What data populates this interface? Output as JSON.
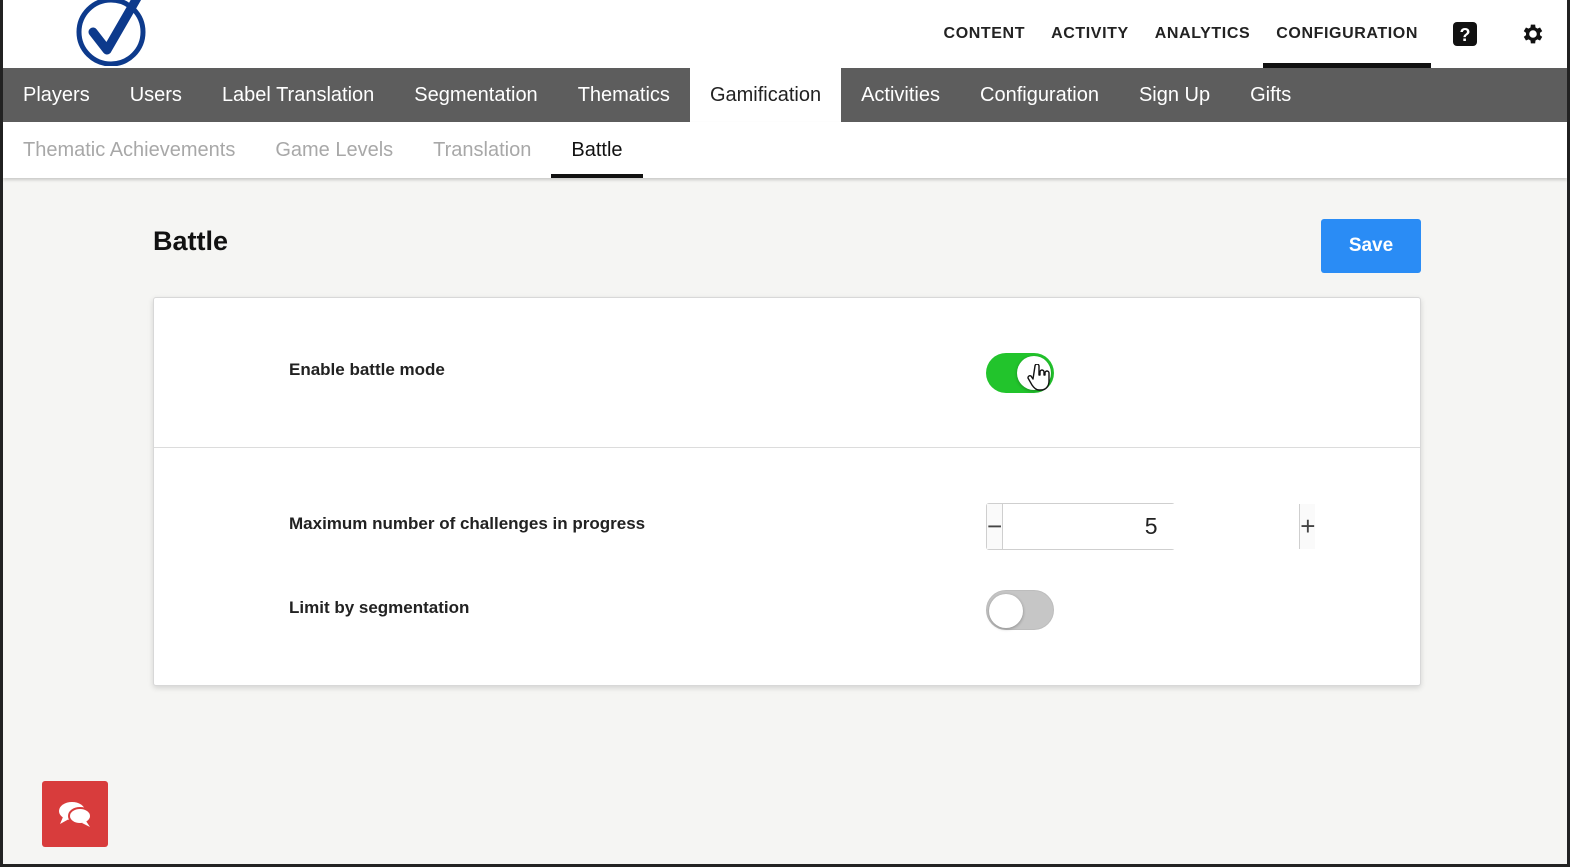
{
  "top_nav": {
    "items": [
      {
        "label": "CONTENT",
        "active": false
      },
      {
        "label": "ACTIVITY",
        "active": false
      },
      {
        "label": "ANALYTICS",
        "active": false
      },
      {
        "label": "CONFIGURATION",
        "active": true
      }
    ],
    "icons": [
      "help-icon",
      "gear-icon"
    ]
  },
  "main_nav": {
    "items": [
      {
        "label": "Players"
      },
      {
        "label": "Users"
      },
      {
        "label": "Label Translation"
      },
      {
        "label": "Segmentation"
      },
      {
        "label": "Thematics"
      },
      {
        "label": "Gamification",
        "active": true
      },
      {
        "label": "Activities"
      },
      {
        "label": "Configuration"
      },
      {
        "label": "Sign Up"
      },
      {
        "label": "Gifts"
      }
    ]
  },
  "sub_nav": {
    "items": [
      {
        "label": "Thematic Achievements"
      },
      {
        "label": "Game Levels"
      },
      {
        "label": "Translation"
      },
      {
        "label": "Battle",
        "active": true
      }
    ]
  },
  "page": {
    "title": "Battle",
    "save_label": "Save"
  },
  "settings": {
    "enable_battle_mode": {
      "label": "Enable battle mode",
      "on": true
    },
    "max_challenges": {
      "label": "Maximum number of challenges in progress",
      "value": "5",
      "minus": "−",
      "plus": "+"
    },
    "limit_by_segmentation": {
      "label": "Limit by segmentation",
      "on": false
    }
  },
  "colors": {
    "accent_blue": "#2a8cf5",
    "toggle_on": "#22c42c",
    "nav_gray": "#5d5d5d",
    "chat_red": "#d83c3c",
    "logo_blue": "#0d3a8c"
  }
}
